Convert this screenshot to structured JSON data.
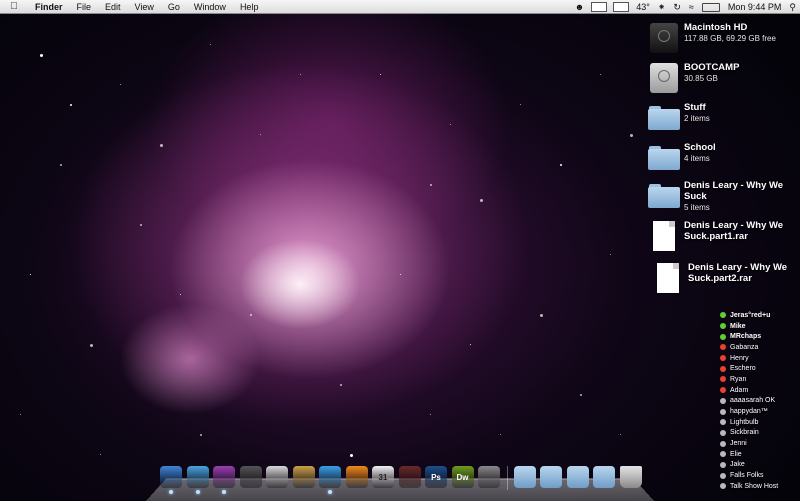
{
  "menubar": {
    "app_name": "Finder",
    "items": [
      "File",
      "Edit",
      "View",
      "Go",
      "Window",
      "Help"
    ],
    "status": {
      "temperature": "43°",
      "clock": "Mon 9:44 PM"
    },
    "icons": [
      "apple-icon",
      "user-icon",
      "battery-icon",
      "bluetooth-icon",
      "time-machine-icon",
      "wifi-icon",
      "spotlight-icon"
    ]
  },
  "desktop": {
    "items": [
      {
        "name": "Macintosh HD",
        "sub": "117.88 GB, 69.29 GB free",
        "icon": "hard-drive-icon"
      },
      {
        "name": "BOOTCAMP",
        "sub": "30.85 GB",
        "icon": "hard-drive-icon"
      },
      {
        "name": "Stuff",
        "sub": "2 items",
        "icon": "folder-icon"
      },
      {
        "name": "School",
        "sub": "4 items",
        "icon": "folder-icon"
      },
      {
        "name": "Denis Leary - Why We Suck",
        "sub": "5 items",
        "icon": "folder-icon"
      },
      {
        "name": "Denis Leary - Why We Suck.part1.rar",
        "sub": "",
        "icon": "document-icon"
      },
      {
        "name": "Denis Leary - Why We Suck.part2.rar",
        "sub": "",
        "icon": "document-icon"
      }
    ]
  },
  "buddies": [
    {
      "name": "Jeras°red+u",
      "status": "green",
      "bold": true
    },
    {
      "name": "Mike",
      "status": "green",
      "bold": true
    },
    {
      "name": "MRchaps",
      "status": "green",
      "bold": true
    },
    {
      "name": "Gabanza",
      "status": "red",
      "bold": false
    },
    {
      "name": "Henry",
      "status": "red",
      "bold": false
    },
    {
      "name": "Eschero",
      "status": "red",
      "bold": false
    },
    {
      "name": "Ryan",
      "status": "red",
      "bold": false
    },
    {
      "name": "Adam",
      "status": "red",
      "bold": false
    },
    {
      "name": "aaaasarah OK",
      "status": "gray",
      "bold": false
    },
    {
      "name": "happydan™",
      "status": "gray",
      "bold": false
    },
    {
      "name": "Lightbulb",
      "status": "gray",
      "bold": false
    },
    {
      "name": "Sickbrain",
      "status": "gray",
      "bold": false
    },
    {
      "name": "Jenni",
      "status": "gray",
      "bold": false
    },
    {
      "name": "Elie",
      "status": "gray",
      "bold": false
    },
    {
      "name": "Jake",
      "status": "gray",
      "bold": false
    },
    {
      "name": "Falls Folks",
      "status": "gray",
      "bold": false
    },
    {
      "name": "Talk Show Host",
      "status": "gray",
      "bold": false
    }
  ],
  "status_colors": {
    "green": "#5fd032",
    "red": "#e8422e",
    "gray": "#b9b9b9"
  },
  "dock": {
    "apps": [
      {
        "icon": "finder-icon",
        "label": "",
        "color": "#3f86d8",
        "running": true
      },
      {
        "icon": "safari-icon",
        "label": "",
        "color": "#4aa3e0",
        "running": true
      },
      {
        "icon": "adium-icon",
        "label": "",
        "color": "#9a3fb0",
        "running": true
      },
      {
        "icon": "preview-icon",
        "label": "",
        "color": "#555555",
        "running": false
      },
      {
        "icon": "textedit-icon",
        "label": "",
        "color": "#d9d9d9",
        "running": false
      },
      {
        "icon": "packages-icon",
        "label": "",
        "color": "#c9a24a",
        "running": false
      },
      {
        "icon": "itunes-icon",
        "label": "",
        "color": "#3aa0e8",
        "running": true
      },
      {
        "icon": "vlc-icon",
        "label": "",
        "color": "#f08a1c",
        "running": false
      },
      {
        "icon": "ical-icon",
        "label": "31",
        "color": "#f2f2f2",
        "running": false
      },
      {
        "icon": "game-icon",
        "label": "",
        "color": "#6b2a2a",
        "running": false
      },
      {
        "icon": "photoshop-icon",
        "label": "Ps",
        "color": "#1d4f8c",
        "running": false
      },
      {
        "icon": "dreamweaver-icon",
        "label": "Dw",
        "color": "#6e9e1f",
        "running": false
      },
      {
        "icon": "system-preferences-icon",
        "label": "",
        "color": "#8a8a8a",
        "running": false
      }
    ],
    "stacks": [
      {
        "icon": "applications-folder-icon",
        "label": ""
      },
      {
        "icon": "documents-folder-icon",
        "label": ""
      },
      {
        "icon": "downloads-folder-icon",
        "label": ""
      },
      {
        "icon": "folder-icon",
        "label": ""
      }
    ],
    "trash": {
      "icon": "trash-icon"
    }
  }
}
